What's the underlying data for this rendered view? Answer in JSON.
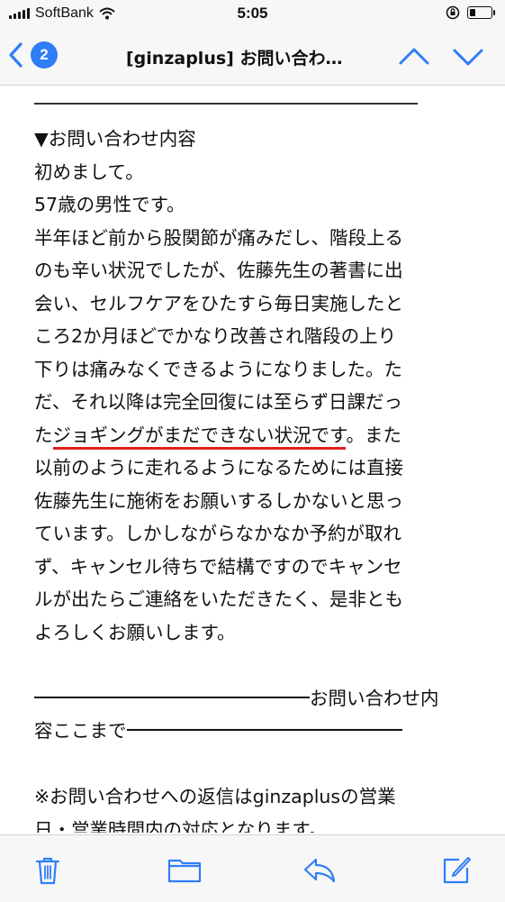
{
  "status_bar": {
    "carrier": "SoftBank",
    "time": "5:05"
  },
  "nav": {
    "unread_count": "2",
    "title": "[ginzaplus] お問い合わ…"
  },
  "email": {
    "lines": [
      "▼お問い合わせ内容",
      "初めまして。",
      "57歳の男性です。",
      "半年ほど前から股関節が痛みだし、階段上る",
      "のも辛い状況でしたが、佐藤先生の著書に出",
      "会い、セルフケアをひたすら毎日実施したと",
      "ころ2か月ほどでかなり改善され階段の上り",
      "下りは痛みなくできるようになりました。た",
      "だ、それ以降は完全回復には至らず日課だっ"
    ],
    "highlight_line": {
      "before": "た",
      "underlined": "ジョギングがまだできない状況です",
      "after": "。また"
    },
    "lines2": [
      "以前のように走れるようになるためには直接",
      "佐藤先生に施術をお願いするしかないと思っ",
      "ています。しかしながらなかなか予約が取れ",
      "ず、キャンセル待ちで結構ですのでキャンセ",
      "ルが出たらご連絡をいただきたく、是非とも",
      "よろしくお願いします。"
    ],
    "end_marker_part1": "お問い合わせ内",
    "end_marker_part2": "容ここまで",
    "note_lines": [
      "※お問い合わせへの返信はginzaplusの営業",
      "日・営業時間内の対応となります。"
    ]
  },
  "toolbar": {
    "icons": [
      "trash-icon",
      "folder-icon",
      "reply-icon",
      "compose-icon"
    ]
  },
  "colors": {
    "accent": "#2f7ef7",
    "underline": "#e0201c"
  }
}
